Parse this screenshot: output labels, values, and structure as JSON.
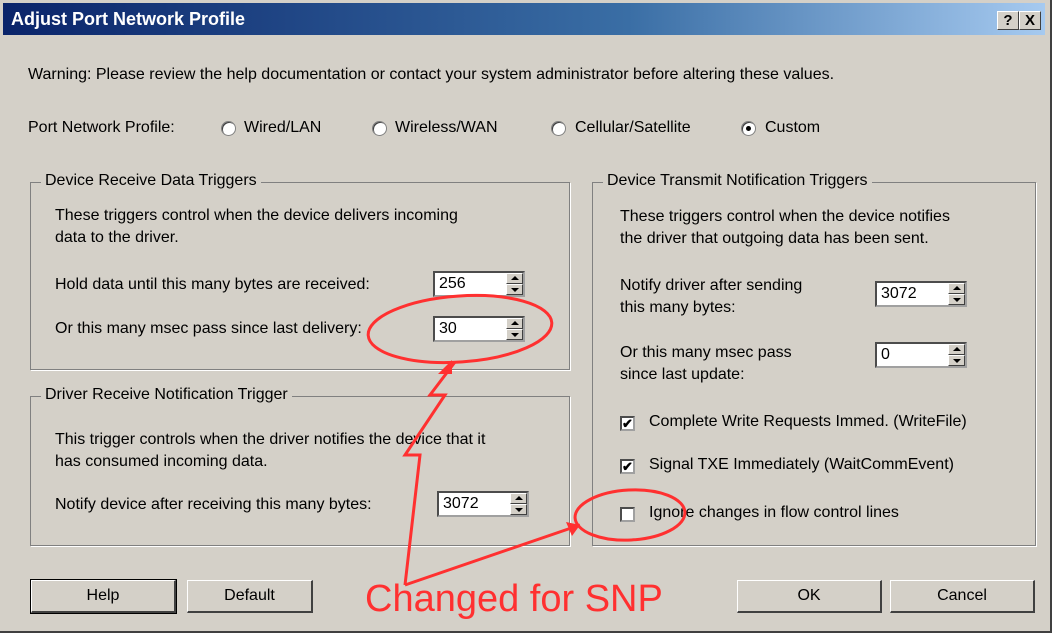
{
  "window": {
    "title": "Adjust Port Network Profile",
    "help_glyph": "?",
    "close_glyph": "X"
  },
  "warning": "Warning:  Please review the help documentation or contact your system administrator before altering these values.",
  "profile": {
    "label": "Port Network Profile:",
    "options": [
      "Wired/LAN",
      "Wireless/WAN",
      "Cellular/Satellite",
      "Custom"
    ],
    "selected": "Custom"
  },
  "receive_group": {
    "title": "Device Receive Data Triggers",
    "desc_line1": "These triggers control when the device delivers incoming",
    "desc_line2": "data to the driver.",
    "hold_label": "Hold data until this many bytes are received:",
    "hold_value": "256",
    "msec_label": "Or this many msec pass since last delivery:",
    "msec_value": "30"
  },
  "driver_group": {
    "title": "Driver Receive Notification Trigger",
    "desc_line1": "This trigger controls when the driver notifies the device that it",
    "desc_line2": "has consumed incoming data.",
    "notify_label": "Notify device after receiving this many bytes:",
    "notify_value": "3072"
  },
  "transmit_group": {
    "title": "Device Transmit Notification Triggers",
    "desc_line1": "These triggers control when the device notifies",
    "desc_line2": "the driver that outgoing data has been sent.",
    "bytes_label_line1": "Notify driver after sending",
    "bytes_label_line2": "this many bytes:",
    "bytes_value": "3072",
    "msec_label_line1": "Or this many msec pass",
    "msec_label_line2": "since last update:",
    "msec_value": "0",
    "checkboxes": [
      {
        "label": "Complete Write Requests Immed. (WriteFile)",
        "checked": true
      },
      {
        "label": "Signal TXE Immediately (WaitCommEvent)",
        "checked": true
      },
      {
        "label": "Ignore changes in flow control lines",
        "checked": false
      }
    ]
  },
  "buttons": {
    "help": "Help",
    "default": "Default",
    "ok": "OK",
    "cancel": "Cancel"
  },
  "annotation": {
    "text": "Changed for SNP",
    "color": "#ff3030"
  }
}
